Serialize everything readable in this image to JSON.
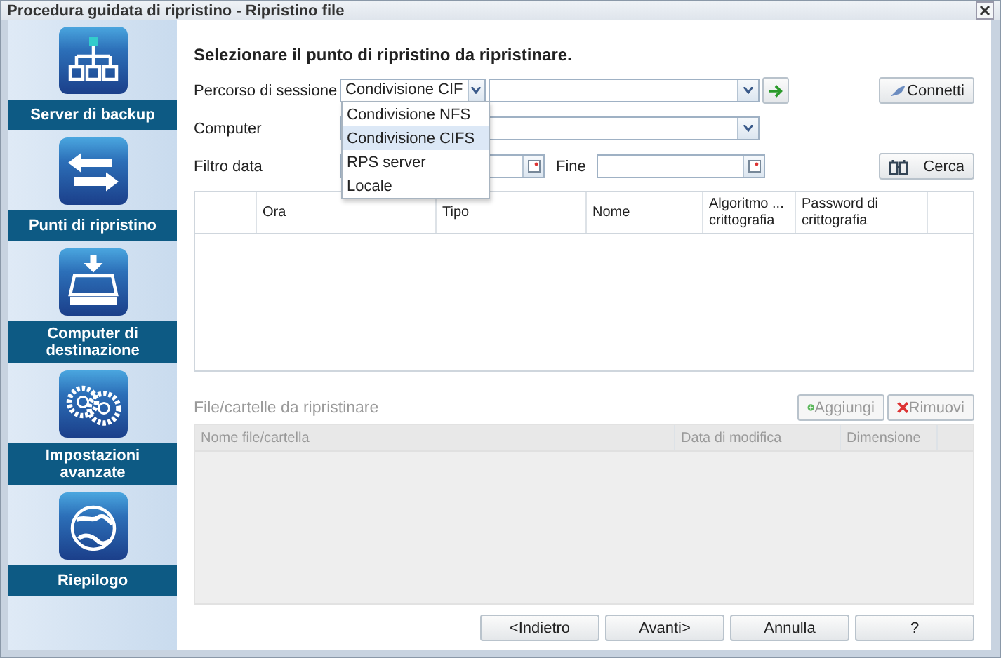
{
  "window": {
    "title": "Procedura guidata di ripristino - Ripristino file"
  },
  "steps": [
    {
      "label": "Server di backup"
    },
    {
      "label": "Punti di ripristino"
    },
    {
      "label": "Computer di destinazione"
    },
    {
      "label": "Impostazioni avanzate"
    },
    {
      "label": "Riepilogo"
    }
  ],
  "heading": "Selezionare il punto di ripristino da ripristinare.",
  "session": {
    "label": "Percorso di sessione",
    "type_value": "Condivisione CIF",
    "connect_button": "Connetti",
    "dropdown": [
      {
        "label": "Condivisione NFS",
        "selected": false
      },
      {
        "label": "Condivisione CIFS",
        "selected": true
      },
      {
        "label": "RPS server",
        "selected": false
      },
      {
        "label": "Locale",
        "selected": false
      }
    ]
  },
  "computer": {
    "label": "Computer"
  },
  "date_filter": {
    "label": "Filtro data",
    "end_label": "Fine",
    "search_button": "Cerca"
  },
  "recovery_points": {
    "columns": [
      "Ora",
      "Tipo",
      "Nome",
      "Algoritmo ... crittografia",
      "Password di crittografia"
    ]
  },
  "files": {
    "title": "File/cartelle da ripristinare",
    "disabled": true,
    "add_button": "Aggiungi",
    "remove_button": "Rimuovi",
    "columns": [
      "Nome file/cartella",
      "Data di modifica",
      "Dimensione"
    ]
  },
  "buttons": [
    "<Indietro",
    "Avanti>",
    "Annulla",
    "?"
  ]
}
